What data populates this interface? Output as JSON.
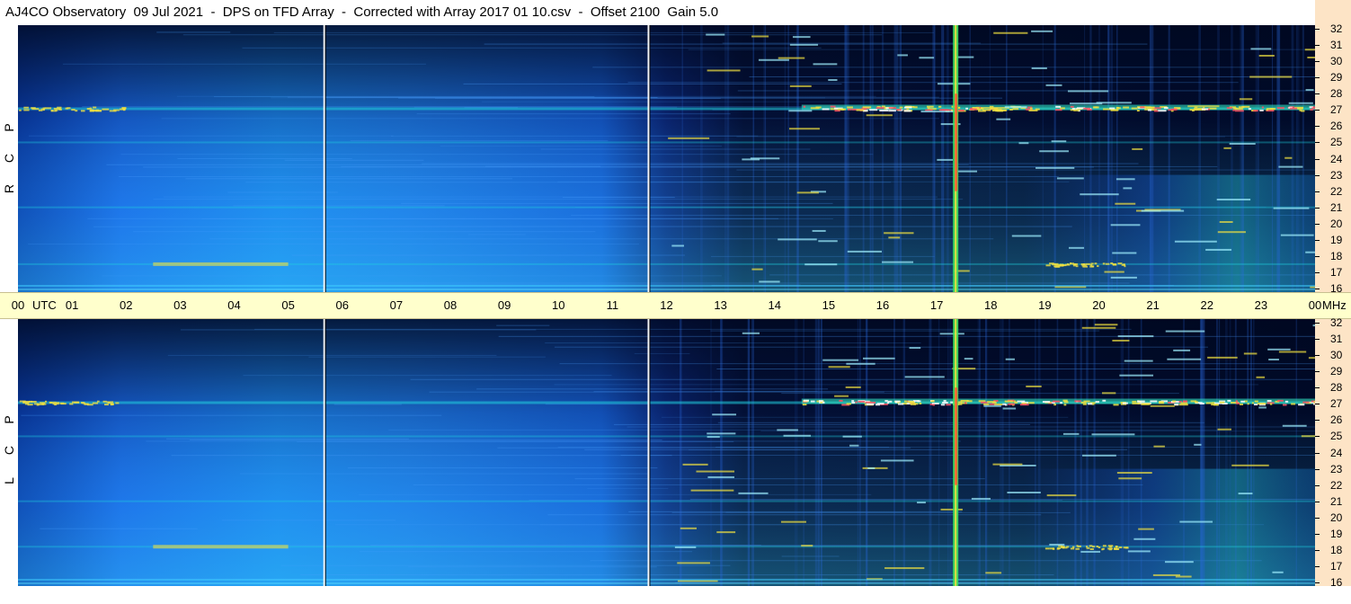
{
  "title": "AJ4CO Observatory  09 Jul 2021  -  DPS on TFD Array  -  Corrected with Array 2017 01 10.csv  -  Offset 2100  Gain 5.0",
  "chart_data": [
    {
      "type": "heatmap",
      "name": "RCP",
      "pol_letters": [
        "R",
        "C",
        "P"
      ],
      "x_axis": {
        "label": "UTC",
        "range_hours": [
          0,
          24
        ]
      },
      "y_axis": {
        "label": "MHz",
        "range": [
          16,
          32
        ]
      },
      "bright_bands_mhz": [
        27.1,
        17.5,
        21.0,
        25.0
      ],
      "vertical_markers_utc_hours": [
        5.65,
        11.65,
        17.35
      ]
    },
    {
      "type": "heatmap",
      "name": "LCP",
      "pol_letters": [
        "L",
        "C",
        "P"
      ],
      "x_axis": {
        "label": "UTC",
        "range_hours": [
          0,
          24
        ]
      },
      "y_axis": {
        "label": "MHz",
        "range": [
          16,
          32
        ]
      },
      "bright_bands_mhz": [
        27.1,
        18.2,
        21.0,
        25.0
      ],
      "vertical_markers_utc_hours": [
        5.65,
        11.65,
        17.35
      ]
    }
  ],
  "time_axis": {
    "utc_label": "UTC",
    "mhz_label": "MHz",
    "ticks": [
      "00",
      "01",
      "02",
      "03",
      "04",
      "05",
      "06",
      "07",
      "08",
      "09",
      "10",
      "11",
      "12",
      "13",
      "14",
      "15",
      "16",
      "17",
      "18",
      "19",
      "20",
      "21",
      "22",
      "23",
      "00"
    ]
  },
  "freq_axis": {
    "ticks": [
      "32",
      "31",
      "30",
      "29",
      "28",
      "27",
      "26",
      "25",
      "24",
      "23",
      "22",
      "21",
      "20",
      "19",
      "18",
      "17",
      "16"
    ]
  },
  "colors": {
    "background_dark": "#000a2a",
    "plasma_blue": "#1a64e6",
    "cyan": "#20d0e0",
    "band_warm": "#f0e040",
    "axis_bg": "#ffffcc",
    "freq_bg": "#fde4c6"
  }
}
